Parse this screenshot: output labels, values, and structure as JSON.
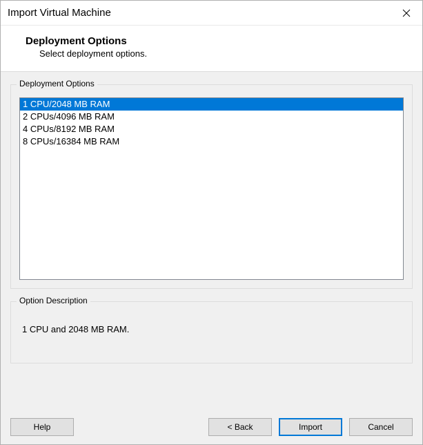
{
  "window": {
    "title": "Import Virtual Machine"
  },
  "header": {
    "title": "Deployment Options",
    "subtitle": "Select deployment options."
  },
  "deployment": {
    "group_label": "Deployment Options",
    "selected_index": 0,
    "options": [
      "1 CPU/2048 MB RAM",
      "2 CPUs/4096 MB RAM",
      "4 CPUs/8192 MB RAM",
      "8 CPUs/16384 MB RAM"
    ]
  },
  "description": {
    "group_label": "Option Description",
    "text": "1 CPU and 2048 MB RAM."
  },
  "buttons": {
    "help": "Help",
    "back": "< Back",
    "import": "Import",
    "cancel": "Cancel"
  }
}
